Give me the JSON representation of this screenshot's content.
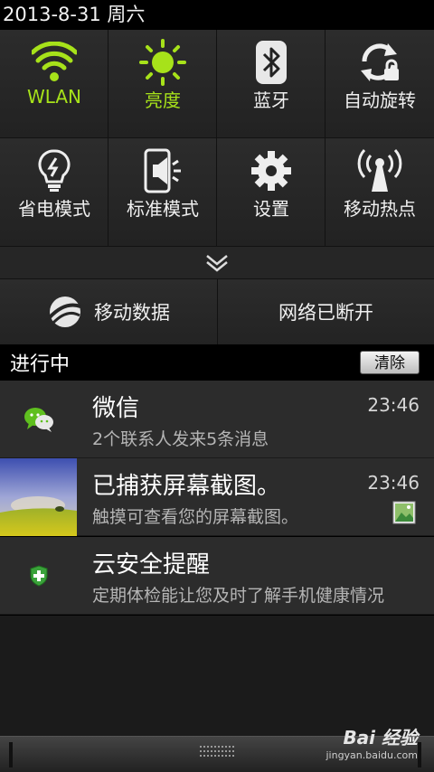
{
  "status_bar": {
    "date": "2013-8-31 周六"
  },
  "quick_settings": {
    "tiles": [
      {
        "label": "WLAN",
        "icon": "wifi-icon",
        "active": true
      },
      {
        "label": "亮度",
        "icon": "brightness-icon",
        "active": true
      },
      {
        "label": "蓝牙",
        "icon": "bluetooth-icon",
        "active": false
      },
      {
        "label": "自动旋转",
        "icon": "auto-rotate-icon",
        "active": false
      },
      {
        "label": "省电模式",
        "icon": "power-saving-icon",
        "active": false
      },
      {
        "label": "标准模式",
        "icon": "sound-mode-icon",
        "active": false
      },
      {
        "label": "设置",
        "icon": "settings-gear-icon",
        "active": false
      },
      {
        "label": "移动热点",
        "icon": "hotspot-icon",
        "active": false
      }
    ],
    "expand_icon": "double-chevron-down-icon",
    "mobile_data_label": "移动数据",
    "network_label": "网络已断开",
    "accent_color": "#a7e21a"
  },
  "ongoing": {
    "title": "进行中",
    "clear_label": "清除"
  },
  "notifications": [
    {
      "title": "微信",
      "text": "2个联系人发来5条消息",
      "time": "23:46",
      "icon": "wechat-icon"
    },
    {
      "title": "已捕获屏幕截图。",
      "text": "触摸可查看您的屏幕截图。",
      "time": "23:46",
      "icon": "screenshot-thumbnail",
      "small_icon": "image-icon"
    },
    {
      "title": "云安全提醒",
      "text": "定期体检能让您及时了解手机健康情况",
      "time": "",
      "icon": "shield-icon"
    }
  ],
  "watermark": {
    "logo": "Bai 经验",
    "url": "jingyan.baidu.com"
  }
}
